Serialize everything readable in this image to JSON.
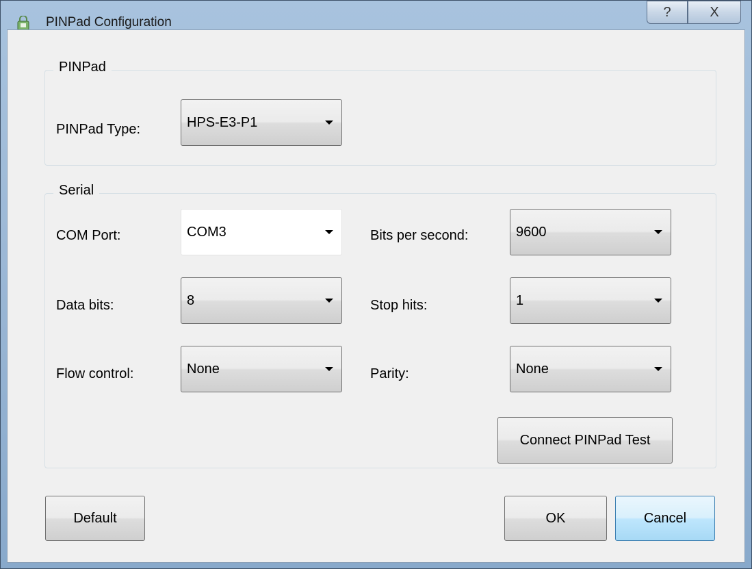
{
  "window": {
    "title": "PINPad Configuration",
    "help_glyph": "?",
    "close_glyph": "X",
    "icon": "pinpad-lock-icon"
  },
  "pinpad_group": {
    "title": "PINPad",
    "type_label": "PINPad Type:",
    "type_value": "HPS-E3-P1"
  },
  "serial_group": {
    "title": "Serial",
    "com_port_label": "COM Port:",
    "com_port_value": "COM3",
    "bps_label": "Bits per second:",
    "bps_value": "9600",
    "data_bits_label": "Data bits:",
    "data_bits_value": "8",
    "stop_bits_label": "Stop hits:",
    "stop_bits_value": "1",
    "flow_label": "Flow control:",
    "flow_value": "None",
    "parity_label": "Parity:",
    "parity_value": "None",
    "test_button": "Connect PINPad Test"
  },
  "footer": {
    "default_button": "Default",
    "ok_button": "OK",
    "cancel_button": "Cancel"
  }
}
